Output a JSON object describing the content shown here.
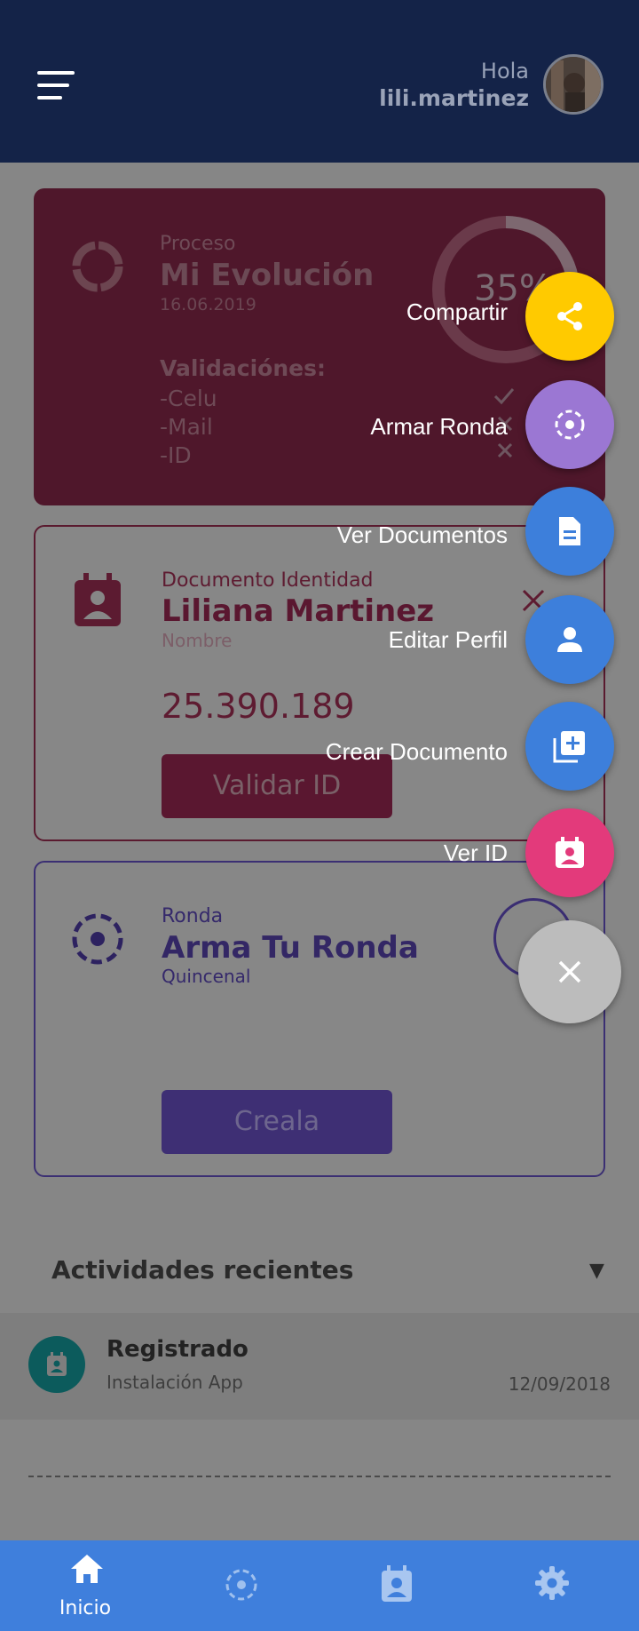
{
  "header": {
    "greeting": "Hola",
    "username": "lili.martinez"
  },
  "evolution_card": {
    "overline": "Proceso",
    "title": "Mi Evolución",
    "date": "16.06.2019",
    "percent": "35%",
    "progress_fraction": 0.35,
    "validations_title": "Validaciónes:",
    "validations": [
      "-Celu",
      "-Mail",
      "-ID"
    ]
  },
  "id_card": {
    "overline": "Documento Identidad",
    "name": "Liliana Martinez",
    "name_label": "Nombre",
    "number": "25.390.189",
    "button_label": "Validar ID"
  },
  "ronda_card": {
    "overline": "Ronda",
    "title": "Arma Tu Ronda",
    "frequency": "Quincenal",
    "button_label": "Creala"
  },
  "activities": {
    "title": "Actividades recientes",
    "items": [
      {
        "name": "Registrado",
        "detail": "Instalación App",
        "date": "12/09/2018"
      }
    ]
  },
  "speed_dial": {
    "actions": [
      {
        "label": "Compartir",
        "color": "#ffca00",
        "icon": "share-icon"
      },
      {
        "label": "Armar Ronda",
        "color": "#9b77d3",
        "icon": "ronda-icon"
      },
      {
        "label": "Ver Documentos",
        "color": "#3d7fdb",
        "icon": "document-icon"
      },
      {
        "label": "Editar Perfil",
        "color": "#3d7fdb",
        "icon": "person-icon"
      },
      {
        "label": "Crear Documento",
        "color": "#3d7fdb",
        "icon": "add-document-icon"
      },
      {
        "label": "Ver ID",
        "color": "#e33a7b",
        "icon": "id-badge-icon"
      }
    ],
    "close_color": "#bcbcbc"
  },
  "bottom_nav": {
    "items": [
      {
        "label": "Inicio",
        "icon": "home-icon"
      },
      {
        "label": "",
        "icon": "ronda-icon"
      },
      {
        "label": "",
        "icon": "id-badge-icon"
      },
      {
        "label": "",
        "icon": "gear-icon"
      }
    ]
  }
}
